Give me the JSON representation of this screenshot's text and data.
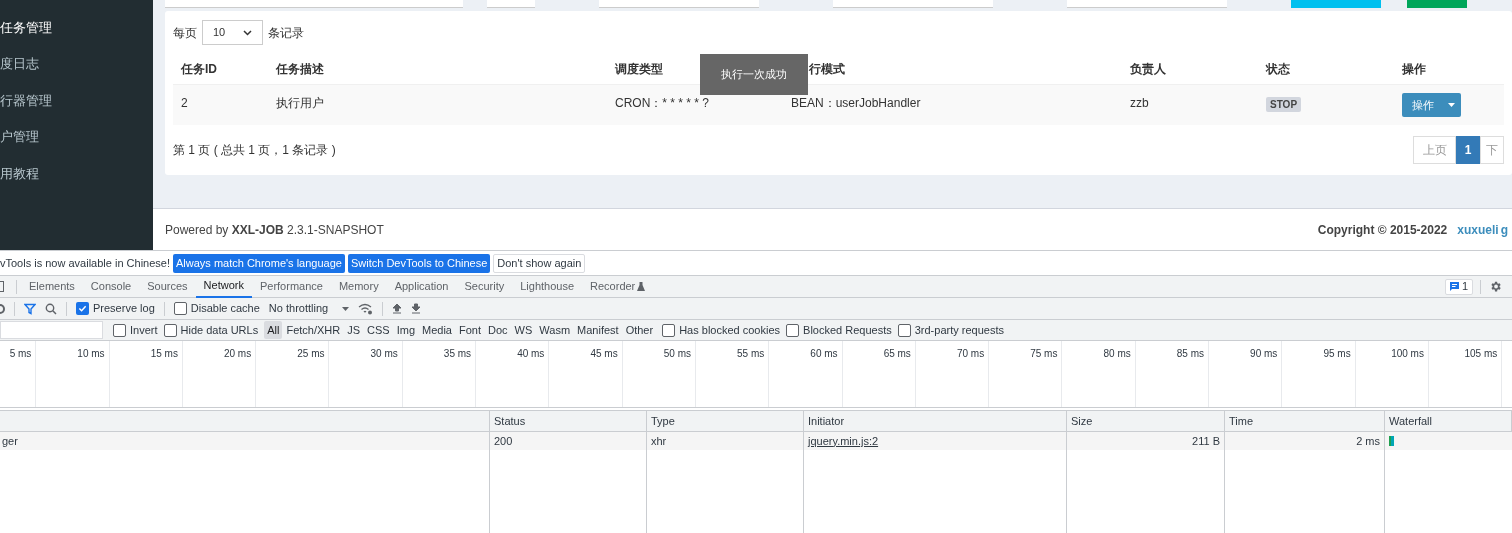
{
  "sidebar": {
    "items": [
      {
        "label": "任务管理",
        "selected": true
      },
      {
        "label": "度日志",
        "selected": false
      },
      {
        "label": "行器管理",
        "selected": false
      },
      {
        "label": "户管理",
        "selected": false
      },
      {
        "label": "用教程",
        "selected": false
      }
    ]
  },
  "page_size": {
    "before": "每页",
    "value": "10",
    "after": "条记录"
  },
  "table": {
    "columns": [
      "任务ID",
      "任务描述",
      "调度类型",
      "行模式",
      "负责人",
      "状态",
      "操作"
    ],
    "rows": [
      {
        "id": "2",
        "desc": "执行用户",
        "schedule": "CRON：* * * * * ?",
        "mode": "BEAN：userJobHandler",
        "owner": "zzb",
        "status": "STOP",
        "action": "操作"
      }
    ]
  },
  "toast": "执行一次成功",
  "summary": "第 1 页 ( 总共 1 页，1 条记录 )",
  "pagination": [
    {
      "label": "上页",
      "selected": false
    },
    {
      "label": "1",
      "selected": true
    },
    {
      "label": "下",
      "selected": false
    }
  ],
  "footer": {
    "powered": "Powered by **XXL-JOB** 2.3.1-SNAPSHOT",
    "copyright": "Copyright © 2015-2022",
    "links": [
      "xuxueli",
      "g"
    ]
  },
  "devtools": {
    "banner": {
      "text": "vTools is now available in Chinese!",
      "buttons": [
        {
          "label": "Always match Chrome's language",
          "kind": "primary"
        },
        {
          "label": "Switch DevTools to Chinese",
          "kind": "primary"
        },
        {
          "label": "Don't show again",
          "kind": "plain"
        }
      ]
    },
    "tabs": [
      {
        "label": "Elements",
        "selected": false
      },
      {
        "label": "Console",
        "selected": false
      },
      {
        "label": "Sources",
        "selected": false
      },
      {
        "label": "Network",
        "selected": true
      },
      {
        "label": "Performance",
        "selected": false
      },
      {
        "label": "Memory",
        "selected": false
      },
      {
        "label": "Application",
        "selected": false
      },
      {
        "label": "Security",
        "selected": false
      },
      {
        "label": "Lighthouse",
        "selected": false
      },
      {
        "label": "Recorder",
        "selected": false
      }
    ],
    "issues": "1",
    "toolbar": {
      "preserve_log": {
        "label": "Preserve log",
        "checked": true
      },
      "disable_cache": {
        "label": "Disable cache",
        "checked": false
      },
      "throttling": "No throttling"
    },
    "filters": {
      "checks": [
        {
          "label": "Invert",
          "checked": false
        },
        {
          "label": "Hide data URLs",
          "checked": false
        }
      ],
      "types": [
        {
          "label": "All",
          "selected": true
        },
        {
          "label": "Fetch/XHR",
          "selected": false
        },
        {
          "label": "JS",
          "selected": false
        },
        {
          "label": "CSS",
          "selected": false
        },
        {
          "label": "Img",
          "selected": false
        },
        {
          "label": "Media",
          "selected": false
        },
        {
          "label": "Font",
          "selected": false
        },
        {
          "label": "Doc",
          "selected": false
        },
        {
          "label": "WS",
          "selected": false
        },
        {
          "label": "Wasm",
          "selected": false
        },
        {
          "label": "Manifest",
          "selected": false
        },
        {
          "label": "Other",
          "selected": false
        }
      ],
      "more_checks": [
        {
          "label": "Has blocked cookies",
          "checked": false
        },
        {
          "label": "Blocked Requests",
          "checked": false
        },
        {
          "label": "3rd-party requests",
          "checked": false
        }
      ]
    },
    "timeline": [
      "5 ms",
      "10 ms",
      "15 ms",
      "20 ms",
      "25 ms",
      "30 ms",
      "35 ms",
      "40 ms",
      "45 ms",
      "50 ms",
      "55 ms",
      "60 ms",
      "65 ms",
      "70 ms",
      "75 ms",
      "80 ms",
      "85 ms",
      "90 ms",
      "95 ms",
      "100 ms",
      "105 ms"
    ],
    "requests": {
      "columns": [
        "Status",
        "Type",
        "Initiator",
        "Size",
        "Time",
        "Waterfall"
      ],
      "rows": [
        {
          "name": "ger",
          "status": "200",
          "type": "xhr",
          "initiator": "jquery.min.js:2",
          "size": "211 B",
          "time": "2 ms"
        }
      ]
    }
  }
}
